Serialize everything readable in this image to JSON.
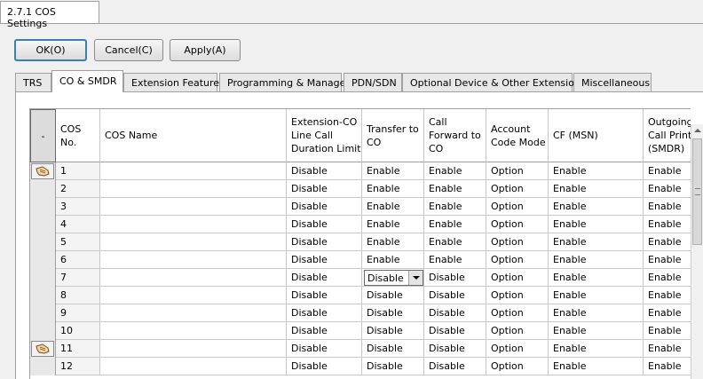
{
  "window_tab": "2.7.1 COS Settings",
  "buttons": {
    "ok": "OK(O)",
    "cancel": "Cancel(C)",
    "apply": "Apply(A)"
  },
  "tabs": [
    {
      "label": "TRS"
    },
    {
      "label": "CO & SMDR",
      "active": true
    },
    {
      "label": "Extension Feature"
    },
    {
      "label": "Programming & Manager"
    },
    {
      "label": "PDN/SDN"
    },
    {
      "label": "Optional Device & Other Extensions"
    },
    {
      "label": "Miscellaneous"
    }
  ],
  "grid": {
    "corner_label": "-",
    "columns": [
      {
        "key": "cos_no",
        "label": "COS No."
      },
      {
        "key": "cos_name",
        "label": "COS Name"
      },
      {
        "key": "ext_co_limit",
        "label": "Extension-CO Line Call Duration Limit"
      },
      {
        "key": "transfer_co",
        "label": "Transfer to CO"
      },
      {
        "key": "call_fwd_co",
        "label": "Call Forward to CO"
      },
      {
        "key": "account_code_mode",
        "label": "Account Code Mode"
      },
      {
        "key": "cf_msn",
        "label": "CF (MSN)"
      },
      {
        "key": "outgoing_print",
        "label": "Outgoing Call Print (SMDR)"
      }
    ],
    "rows": [
      {
        "cos_no": "1",
        "cos_name": "",
        "ext_co_limit": "Disable",
        "transfer_co": "Enable",
        "call_fwd_co": "Enable",
        "account_code_mode": "Option",
        "cf_msn": "Enable",
        "outgoing_print": "Enable",
        "hand": true
      },
      {
        "cos_no": "2",
        "cos_name": "",
        "ext_co_limit": "Disable",
        "transfer_co": "Enable",
        "call_fwd_co": "Enable",
        "account_code_mode": "Option",
        "cf_msn": "Enable",
        "outgoing_print": "Enable"
      },
      {
        "cos_no": "3",
        "cos_name": "",
        "ext_co_limit": "Disable",
        "transfer_co": "Enable",
        "call_fwd_co": "Enable",
        "account_code_mode": "Option",
        "cf_msn": "Enable",
        "outgoing_print": "Enable"
      },
      {
        "cos_no": "4",
        "cos_name": "",
        "ext_co_limit": "Disable",
        "transfer_co": "Enable",
        "call_fwd_co": "Enable",
        "account_code_mode": "Option",
        "cf_msn": "Enable",
        "outgoing_print": "Enable"
      },
      {
        "cos_no": "5",
        "cos_name": "",
        "ext_co_limit": "Disable",
        "transfer_co": "Enable",
        "call_fwd_co": "Enable",
        "account_code_mode": "Option",
        "cf_msn": "Enable",
        "outgoing_print": "Enable"
      },
      {
        "cos_no": "6",
        "cos_name": "",
        "ext_co_limit": "Disable",
        "transfer_co": "Enable",
        "call_fwd_co": "Enable",
        "account_code_mode": "Option",
        "cf_msn": "Enable",
        "outgoing_print": "Enable"
      },
      {
        "cos_no": "7",
        "cos_name": "",
        "ext_co_limit": "Disable",
        "transfer_co": "Disable",
        "call_fwd_co": "Disable",
        "account_code_mode": "Option",
        "cf_msn": "Enable",
        "outgoing_print": "Enable",
        "dropdown": true
      },
      {
        "cos_no": "8",
        "cos_name": "",
        "ext_co_limit": "Disable",
        "transfer_co": "Disable",
        "call_fwd_co": "Disable",
        "account_code_mode": "Option",
        "cf_msn": "Enable",
        "outgoing_print": "Enable"
      },
      {
        "cos_no": "9",
        "cos_name": "",
        "ext_co_limit": "Disable",
        "transfer_co": "Disable",
        "call_fwd_co": "Disable",
        "account_code_mode": "Option",
        "cf_msn": "Enable",
        "outgoing_print": "Enable"
      },
      {
        "cos_no": "10",
        "cos_name": "",
        "ext_co_limit": "Disable",
        "transfer_co": "Disable",
        "call_fwd_co": "Disable",
        "account_code_mode": "Option",
        "cf_msn": "Enable",
        "outgoing_print": "Enable"
      },
      {
        "cos_no": "11",
        "cos_name": "",
        "ext_co_limit": "Disable",
        "transfer_co": "Disable",
        "call_fwd_co": "Disable",
        "account_code_mode": "Option",
        "cf_msn": "Enable",
        "outgoing_print": "Enable",
        "hand": true
      },
      {
        "cos_no": "12",
        "cos_name": "",
        "ext_co_limit": "Disable",
        "transfer_co": "Disable",
        "call_fwd_co": "Disable",
        "account_code_mode": "Option",
        "cf_msn": "Enable",
        "outgoing_print": "Enable"
      }
    ]
  }
}
